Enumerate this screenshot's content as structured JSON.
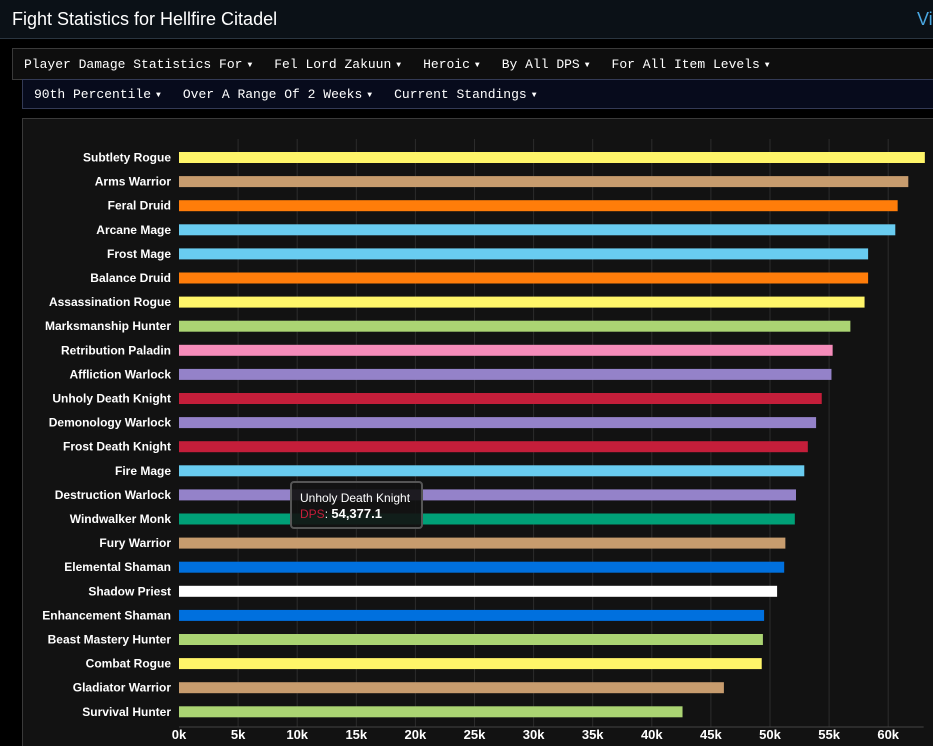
{
  "header": {
    "title": "Fight Statistics for Hellfire Citadel",
    "view_link": "Vi"
  },
  "filters_row1": [
    {
      "label": "Player Damage Statistics For"
    },
    {
      "label": "Fel Lord Zakuun"
    },
    {
      "label": "Heroic"
    },
    {
      "label": "By All DPS"
    },
    {
      "label": "For All Item Levels"
    }
  ],
  "filters_row2": [
    {
      "label": "90th Percentile"
    },
    {
      "label": "Over A Range Of 2 Weeks"
    },
    {
      "label": "Current Standings"
    }
  ],
  "tooltip": {
    "title": "Unholy Death Knight",
    "metric": "DPS",
    "value": "54,377.1"
  },
  "chart_data": {
    "type": "bar",
    "orientation": "horizontal",
    "grid": true,
    "xlim": [
      0,
      63000
    ],
    "x_ticks": [
      0,
      5000,
      10000,
      15000,
      20000,
      25000,
      30000,
      35000,
      40000,
      45000,
      50000,
      55000,
      60000
    ],
    "x_tick_labels": [
      "0k",
      "5k",
      "10k",
      "15k",
      "20k",
      "25k",
      "30k",
      "35k",
      "40k",
      "45k",
      "50k",
      "55k",
      "60k"
    ],
    "categories": [
      "Subtlety Rogue",
      "Arms Warrior",
      "Feral Druid",
      "Arcane Mage",
      "Frost Mage",
      "Balance Druid",
      "Assassination Rogue",
      "Marksmanship Hunter",
      "Retribution Paladin",
      "Affliction Warlock",
      "Unholy Death Knight",
      "Demonology Warlock",
      "Frost Death Knight",
      "Fire Mage",
      "Destruction Warlock",
      "Windwalker Monk",
      "Fury Warrior",
      "Elemental Shaman",
      "Shadow Priest",
      "Enhancement Shaman",
      "Beast Mastery Hunter",
      "Combat Rogue",
      "Gladiator Warrior",
      "Survival Hunter"
    ],
    "values": [
      63100,
      61700,
      60800,
      60600,
      58300,
      58300,
      58000,
      56800,
      55300,
      55200,
      54377.1,
      53900,
      53200,
      52900,
      52200,
      52100,
      51300,
      51200,
      50600,
      49500,
      49400,
      49300,
      46100,
      42600
    ],
    "colors": [
      "#fff569",
      "#c79c6e",
      "#ff7d0a",
      "#69ccf0",
      "#69ccf0",
      "#ff7d0a",
      "#fff569",
      "#abd473",
      "#f58cba",
      "#9482c9",
      "#c41e3a",
      "#9482c9",
      "#c41e3a",
      "#69ccf0",
      "#9482c9",
      "#00a077",
      "#c79c6e",
      "#0070de",
      "#ffffff",
      "#0070de",
      "#abd473",
      "#fff569",
      "#c79c6e",
      "#abd473"
    ]
  }
}
